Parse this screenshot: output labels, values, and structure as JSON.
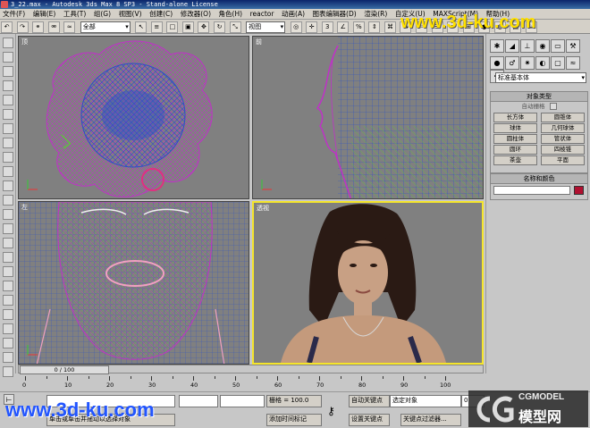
{
  "window": {
    "title": "3_22.max - Autodesk 3ds Max 8 SP3 - Stand-alone License"
  },
  "menu": [
    "文件(F)",
    "编辑(E)",
    "工具(T)",
    "组(G)",
    "视图(V)",
    "创建(C)",
    "修改器(O)",
    "角色(H)",
    "reactor",
    "动画(A)",
    "图表编辑器(D)",
    "渲染(R)",
    "自定义(U)",
    "MAXScript(M)",
    "帮助(H)"
  ],
  "toolbar": {
    "selection_filter": "全部",
    "ref_coord": "视图"
  },
  "viewports": {
    "top": {
      "label": "顶"
    },
    "front": {
      "label": "前"
    },
    "left": {
      "label": "左"
    },
    "perspective": {
      "label": "透视"
    }
  },
  "command_panel": {
    "category_select": "标准基本体",
    "object_type": {
      "header": "对象类型",
      "autogrid": "自动栅格",
      "buttons": [
        "长方体",
        "圆锥体",
        "球体",
        "几何球体",
        "圆柱体",
        "管状体",
        "圆环",
        "四棱锥",
        "茶壶",
        "平面"
      ]
    },
    "name_color": {
      "header": "名称和颜色",
      "color": "#b01030"
    }
  },
  "timeline": {
    "frame_display": "0 / 100",
    "ticks": [
      "0",
      "10",
      "20",
      "30",
      "40",
      "50",
      "60",
      "70",
      "80",
      "90",
      "100"
    ]
  },
  "status": {
    "grid": "栅格 = 100.0",
    "add_time_tag": "添加时间标记",
    "auto_key": "自动关键点",
    "selected_object": "选定对象",
    "set_key": "设置关键点",
    "key_filter": "关键点过滤器...",
    "prompt": "单击或单击并拖动以选择对象",
    "frame_value": "0"
  },
  "watermarks": {
    "top_right": "www.3d-ku.com",
    "bottom_left": "www.3d-ku.com",
    "cgmodel": "CGMODEL",
    "cgmodel_cn": "模型网"
  },
  "colors": {
    "active_viewport": "#f5e52b",
    "wire_blue": "#2a4fc8",
    "wire_magenta": "#c030c8",
    "wire_green": "#60c040"
  }
}
